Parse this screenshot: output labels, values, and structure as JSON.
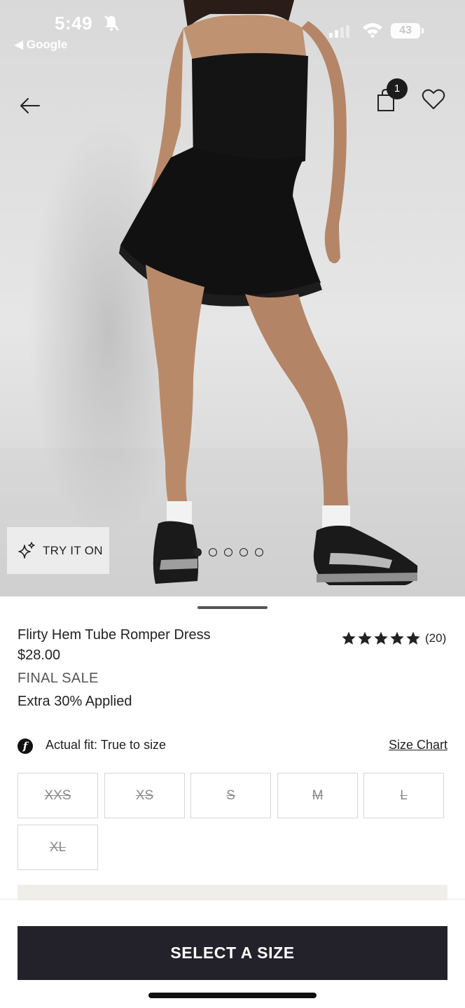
{
  "status_bar": {
    "time": "5:49",
    "back_app": "Google",
    "battery": "43"
  },
  "nav": {
    "cart_count": "1",
    "icons": [
      "back-arrow-icon",
      "shopping-bag-icon",
      "heart-icon"
    ]
  },
  "gallery": {
    "try_on_label": "TRY IT ON",
    "image_count": 5,
    "active_index": 0
  },
  "product": {
    "name": "Flirty Hem Tube Romper Dress",
    "price": "$28.00",
    "sale_label": "FINAL SALE",
    "promo": "Extra 30% Applied",
    "rating_stars": 5,
    "review_count": "(20)"
  },
  "fit": {
    "icon_letter": "f",
    "text": "Actual fit: True to size",
    "size_chart_label": "Size Chart"
  },
  "sizes": [
    {
      "label": "XXS",
      "available": false
    },
    {
      "label": "XS",
      "available": false
    },
    {
      "label": "S",
      "available": false
    },
    {
      "label": "M",
      "available": false
    },
    {
      "label": "L",
      "available": false
    },
    {
      "label": "XL",
      "available": false
    }
  ],
  "cta": {
    "label": "SELECT A SIZE"
  },
  "colors": {
    "cta_bg": "#23222a",
    "dress": "#141414",
    "badge": "#1c1c1c"
  }
}
